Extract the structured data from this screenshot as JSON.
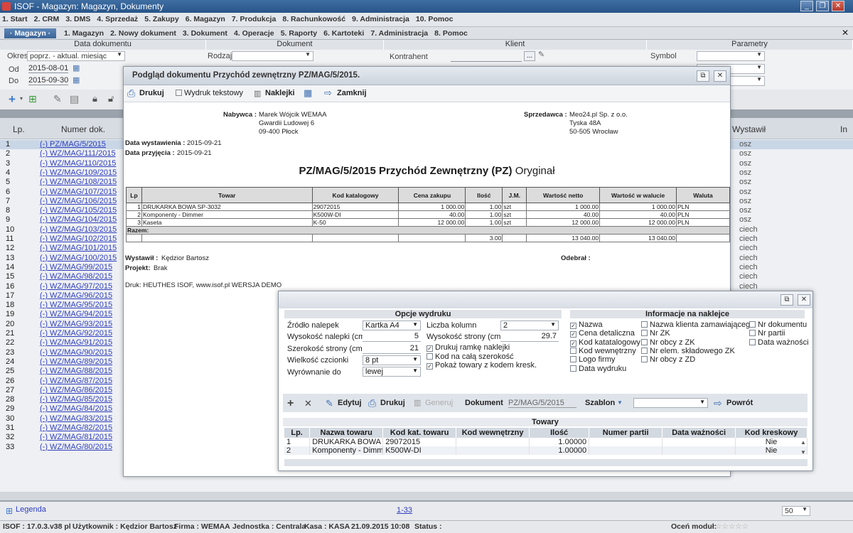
{
  "titlebar": {
    "title": "ISOF - Magazyn: Magazyn, Dokumenty"
  },
  "menu1": [
    "1. Start",
    "2. CRM",
    "3. DMS",
    "4. Sprzedaż",
    "5. Zakupy",
    "6. Magazyn",
    "7. Produkcja",
    "8. Rachunkowość",
    "9. Administracja",
    "10. Pomoc"
  ],
  "menu2": {
    "tag": "· Magazyn ·",
    "items": [
      "1. Magazyn",
      "2. Nowy dokument",
      "3. Dokument",
      "4. Operacje",
      "5. Raporty",
      "6. Kartoteki",
      "7. Administracja",
      "8. Pomoc"
    ]
  },
  "filters": {
    "data_head": "Data dokumentu",
    "dokument_head": "Dokument",
    "klient_head": "Klient",
    "parametry_head": "Parametry",
    "okres_label": "Okres",
    "okres_value": "poprz. - aktual. miesiąc",
    "od_label": "Od",
    "od_value": "2015-08-01",
    "do_label": "Do",
    "do_value": "2015-09-30",
    "rodzaj_label": "Rodzaj",
    "kontrahent_label": "Kontrahent",
    "kontrahent_btn": "...",
    "symbol_label": "Symbol"
  },
  "grid": {
    "col_lp": "Lp.",
    "col_nr": "Numer dok.",
    "col_wystawil": "Wystawił",
    "col_in": "In",
    "rows": [
      {
        "n": "1",
        "doc": "(-) PZ/MAG/5/2015",
        "w": "osz"
      },
      {
        "n": "2",
        "doc": "(-) WZ/MAG/111/2015",
        "w": "osz"
      },
      {
        "n": "3",
        "doc": "(-) WZ/MAG/110/2015",
        "w": "osz"
      },
      {
        "n": "4",
        "doc": "(-) WZ/MAG/109/2015",
        "w": "osz"
      },
      {
        "n": "5",
        "doc": "(-) WZ/MAG/108/2015",
        "w": "osz"
      },
      {
        "n": "6",
        "doc": "(-) WZ/MAG/107/2015",
        "w": "osz"
      },
      {
        "n": "7",
        "doc": "(-) WZ/MAG/106/2015",
        "w": "osz"
      },
      {
        "n": "8",
        "doc": "(-) WZ/MAG/105/2015",
        "w": "osz"
      },
      {
        "n": "9",
        "doc": "(-) WZ/MAG/104/2015",
        "w": "osz"
      },
      {
        "n": "10",
        "doc": "(-) WZ/MAG/103/2015",
        "w": "ciech"
      },
      {
        "n": "11",
        "doc": "(-) WZ/MAG/102/2015",
        "w": "ciech"
      },
      {
        "n": "12",
        "doc": "(-) WZ/MAG/101/2015",
        "w": "ciech"
      },
      {
        "n": "13",
        "doc": "(-) WZ/MAG/100/2015",
        "w": "ciech"
      },
      {
        "n": "14",
        "doc": "(-) WZ/MAG/99/2015",
        "w": "ciech"
      },
      {
        "n": "15",
        "doc": "(-) WZ/MAG/98/2015",
        "w": "ciech"
      },
      {
        "n": "16",
        "doc": "(-) WZ/MAG/97/2015",
        "w": "ciech"
      },
      {
        "n": "17",
        "doc": "(-) WZ/MAG/96/2015",
        "w": ""
      },
      {
        "n": "18",
        "doc": "(-) WZ/MAG/95/2015",
        "w": ""
      },
      {
        "n": "19",
        "doc": "(-) WZ/MAG/94/2015",
        "w": ""
      },
      {
        "n": "20",
        "doc": "(-) WZ/MAG/93/2015",
        "w": ""
      },
      {
        "n": "21",
        "doc": "(-) WZ/MAG/92/2015",
        "w": ""
      },
      {
        "n": "22",
        "doc": "(-) WZ/MAG/91/2015",
        "w": ""
      },
      {
        "n": "23",
        "doc": "(-) WZ/MAG/90/2015",
        "w": ""
      },
      {
        "n": "24",
        "doc": "(-) WZ/MAG/89/2015",
        "w": ""
      },
      {
        "n": "25",
        "doc": "(-) WZ/MAG/88/2015",
        "w": ""
      },
      {
        "n": "26",
        "doc": "(-) WZ/MAG/87/2015",
        "w": ""
      },
      {
        "n": "27",
        "doc": "(-) WZ/MAG/86/2015",
        "w": ""
      },
      {
        "n": "28",
        "doc": "(-) WZ/MAG/85/2015",
        "w": ""
      },
      {
        "n": "29",
        "doc": "(-) WZ/MAG/84/2015",
        "w": ""
      },
      {
        "n": "30",
        "doc": "(-) WZ/MAG/83/2015",
        "w": ""
      },
      {
        "n": "31",
        "doc": "(-) WZ/MAG/82/2015",
        "w": ""
      },
      {
        "n": "32",
        "doc": "(-) WZ/MAG/81/2015",
        "w": ""
      },
      {
        "n": "33",
        "doc": "(-) WZ/MAG/80/2015",
        "w": ""
      }
    ]
  },
  "footer": {
    "legend": "Legenda",
    "pages": "1-33",
    "per_page": "50"
  },
  "status": {
    "isof": "ISOF : 17.0.3.v38 pl",
    "user": "Użytkownik : Kędzior Bartosz",
    "firma": "Firma : WEMAA",
    "jednostka": "Jednostka : Centrala",
    "kasa": "Kasa : KASA",
    "date": "21.09.2015 10:08",
    "status": "Status :",
    "rate": "Oceń moduł:"
  },
  "docwin": {
    "title": "Podgląd dokumentu Przychód zewnętrzny PZ/MAG/5/2015.",
    "toolbar": {
      "print": "Drukuj",
      "text_print": "Wydruk tekstowy",
      "labels": "Naklejki",
      "close": "Zamknij"
    },
    "nabywca_label": "Nabywca :",
    "nabywca": [
      "Marek Wójcik WEMAA",
      "Gwardii Ludowej 6",
      "09-400 Płock"
    ],
    "sprzedawca_label": "Sprzedawca :",
    "sprzedawca": [
      "Meo24.pl Sp. z o.o.",
      "Tyska 48A",
      "50-505 Wrocław"
    ],
    "data_wyst_label": "Data wystawienia :",
    "data_wyst": "2015-09-21",
    "data_przyj_label": "Data przyjęcia :",
    "data_przyj": "2015-09-21",
    "heading": "PZ/MAG/5/2015 Przychód Zewnętrzny (PZ)",
    "heading_suffix": "Oryginał",
    "table": {
      "headers": [
        "Lp",
        "Towar",
        "Kod katalogowy",
        "Cena zakupu",
        "Ilość",
        "J.M.",
        "Wartość netto",
        "Wartość w walucie",
        "Waluta"
      ],
      "rows": [
        [
          "1",
          "DRUKARKA BOWA SP-3032",
          "29072015",
          "1 000.00",
          "1.00",
          "szt",
          "1 000.00",
          "1 000.00",
          "PLN"
        ],
        [
          "2",
          "Komponenty - Dimmer",
          "K500W-DI",
          "40.00",
          "1.00",
          "szt",
          "40.00",
          "40.00",
          "PLN"
        ],
        [
          "3",
          "Kaseta",
          "K-50",
          "12 000.00",
          "1.00",
          "szt",
          "12 000.00",
          "12 000.00",
          "PLN"
        ]
      ],
      "razem": "Razem:",
      "total": [
        "3.00",
        "13 040.00",
        "13 040.00"
      ]
    },
    "wystawil_label": "Wystawił :",
    "wystawil": "Kędzior Bartosz",
    "projekt_label": "Projekt:",
    "projekt": "Brak",
    "odebral_label": "Odebrał :",
    "druk": "Druk: HEUTHES ISOF, www.isof.pl WERSJA DEMO"
  },
  "lblwin": {
    "opcje_head": "Opcje wydruku",
    "info_head": "Informacje na naklejce",
    "zrodlo_label": "Źródło nalepek",
    "zrodlo_value": "Kartka A4",
    "kolumn_label": "Liczba kolumn",
    "kolumn_value": "2",
    "wys_nal_label": "Wysokość nalepki (cm)",
    "wys_nal_value": "5",
    "wys_str_label": "Wysokość strony (cm)",
    "wys_str_value": "29.7",
    "szer_label": "Szerokość strony (cm)",
    "szer_value": "21",
    "czcionka_label": "Wielkość czcionki",
    "czcionka_value": "8 pt",
    "wyrown_label": "Wyrównanie do",
    "wyrown_value": "lewej",
    "chk_ramka": "Drukuj ramkę naklejki",
    "chk_kod": "Kod na całą szerokość",
    "chk_pokaz": "Pokaż towary z kodem kresk.",
    "info_col1": [
      "Nazwa",
      "Cena detaliczna",
      "Kod katatalogowy",
      "Kod wewnętrzny",
      "Logo firmy",
      "Data wydruku"
    ],
    "info_col2": [
      "Nazwa klienta zamawiającego",
      "Nr ZK",
      "Nr obcy z ZK",
      "Nr elem. składowego ZK",
      "Nr obcy z ZD"
    ],
    "info_col3": [
      "Nr dokumentu",
      "Nr partii",
      "Data ważności"
    ],
    "tb": {
      "edit": "Edytuj",
      "print": "Drukuj",
      "gen": "Generuj",
      "dok_label": "Dokument",
      "dok_value": "PZ/MAG/5/2015",
      "szablon": "Szablon",
      "back": "Powrót"
    },
    "towary_head": "Towary",
    "cols": [
      "Lp.",
      "Nazwa towaru",
      "Kod kat. towaru",
      "Kod wewnętrzny",
      "Ilość",
      "Numer partii",
      "Data ważności",
      "Kod kreskowy"
    ],
    "rows": [
      [
        "1",
        "DRUKARKA BOWA SP",
        "29072015",
        "",
        "1.00000",
        "",
        "",
        "Nie"
      ],
      [
        "2",
        "Komponenty - Dimme",
        "K500W-DI",
        "",
        "1.00000",
        "",
        "",
        "Nie"
      ]
    ]
  }
}
